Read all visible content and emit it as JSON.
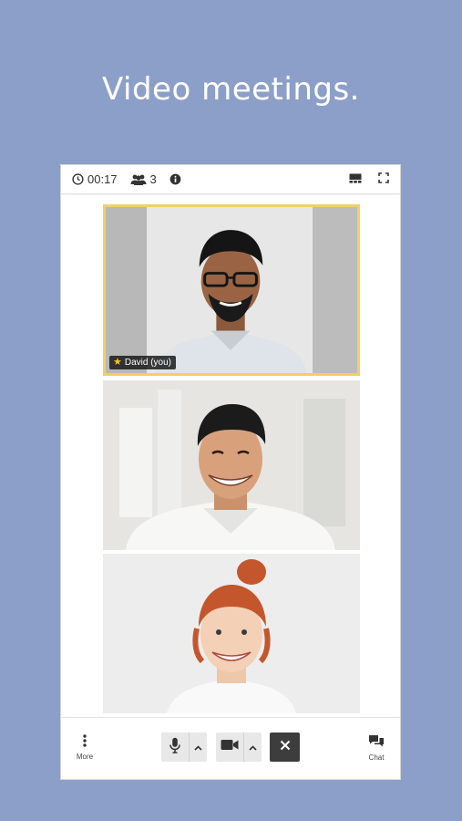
{
  "headline": "Video meetings.",
  "topbar": {
    "timer": "00:17",
    "participants_count": "3",
    "icons": [
      "clock-icon",
      "participants-icon",
      "info-icon",
      "tile-view-icon",
      "fullscreen-icon"
    ]
  },
  "participants": [
    {
      "name_tag": "David (you)",
      "highlighted": true,
      "dominant_speaker_icon": "star-icon"
    },
    {
      "name_tag": ""
    },
    {
      "name_tag": ""
    }
  ],
  "bottombar": {
    "more_label": "More",
    "chat_label": "Chat",
    "icons": [
      "more-icon",
      "microphone-icon",
      "camera-icon",
      "hangup-icon",
      "chat-icon"
    ]
  },
  "colors": {
    "background": "#8c9fc8",
    "highlight_border": "#f2cf6b",
    "hangup": "#3d3d3d"
  }
}
